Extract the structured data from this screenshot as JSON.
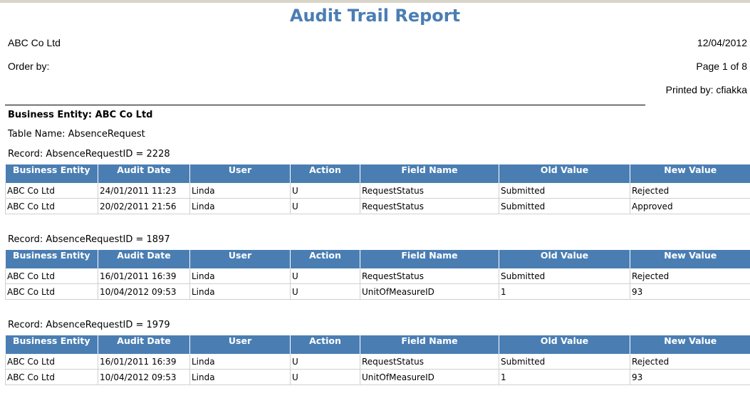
{
  "report": {
    "title": "Audit Trail Report",
    "company": "ABC Co Ltd",
    "date": "12/04/2012",
    "order_by": "Order by:",
    "page": "Page 1 of 8",
    "printed_by": "Printed by: cfiakka",
    "business_entity": "Business Entity: ABC Co Ltd",
    "table_name": "Table Name: AbsenceRequest"
  },
  "columns": [
    "Business Entity",
    "Audit Date",
    "User",
    "Action",
    "Field Name",
    "Old Value",
    "New Value"
  ],
  "records": [
    {
      "label": "Record: AbsenceRequestID = 2228",
      "rows": [
        [
          "ABC Co Ltd",
          "24/01/2011 11:23",
          "Linda",
          "U",
          "RequestStatus",
          "Submitted",
          "Rejected"
        ],
        [
          "ABC Co Ltd",
          "20/02/2011 21:56",
          "Linda",
          "U",
          "RequestStatus",
          "Submitted",
          "Approved"
        ]
      ]
    },
    {
      "label": "Record: AbsenceRequestID = 1897",
      "rows": [
        [
          "ABC Co Ltd",
          "16/01/2011 16:39",
          "Linda",
          "U",
          "RequestStatus",
          "Submitted",
          "Rejected"
        ],
        [
          "ABC Co Ltd",
          "10/04/2012 09:53",
          "Linda",
          "U",
          "UnitOfMeasureID",
          "1",
          "93"
        ]
      ]
    },
    {
      "label": "Record: AbsenceRequestID = 1979",
      "rows": [
        [
          "ABC Co Ltd",
          "16/01/2011 16:39",
          "Linda",
          "U",
          "RequestStatus",
          "Submitted",
          "Rejected"
        ],
        [
          "ABC Co Ltd",
          "10/04/2012 09:53",
          "Linda",
          "U",
          "UnitOfMeasureID",
          "1",
          "93"
        ]
      ]
    }
  ]
}
